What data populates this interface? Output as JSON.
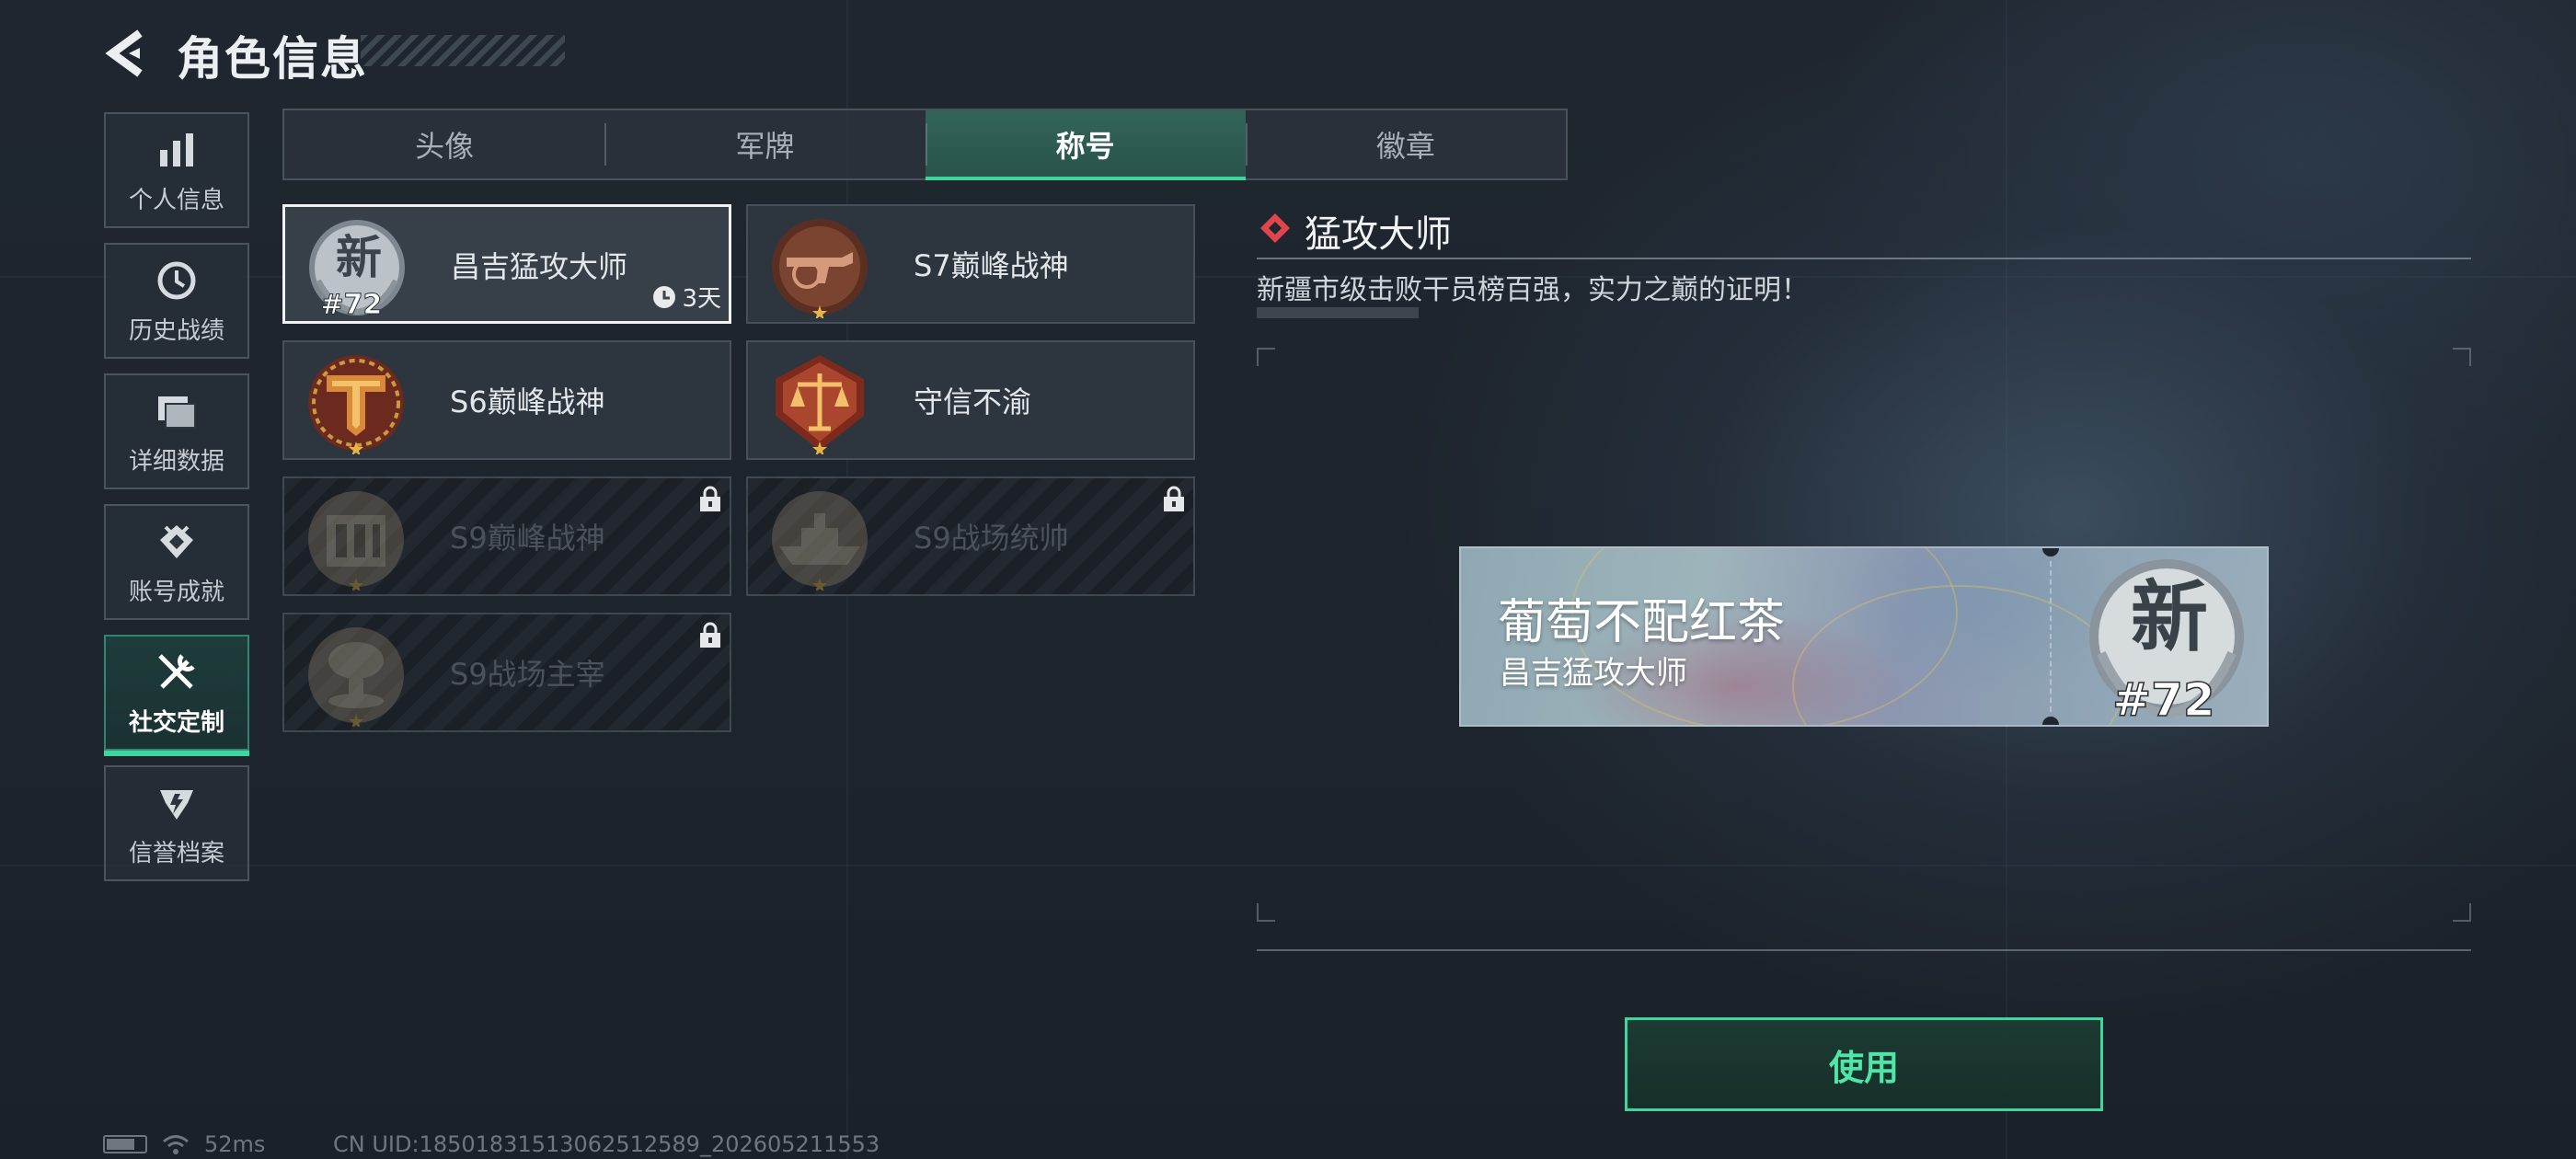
{
  "header": {
    "title": "角色信息"
  },
  "sidebar": {
    "items": [
      {
        "label": "个人信息",
        "icon": "bar-chart-icon",
        "active": false
      },
      {
        "label": "历史战绩",
        "icon": "clock-icon",
        "active": false
      },
      {
        "label": "详细数据",
        "icon": "folder-icon",
        "active": false
      },
      {
        "label": "账号成就",
        "icon": "achievement-icon",
        "active": false
      },
      {
        "label": "社交定制",
        "icon": "tools-icon",
        "active": true
      },
      {
        "label": "信誉档案",
        "icon": "credit-badge-icon",
        "active": false
      }
    ]
  },
  "tabs": [
    {
      "label": "头像",
      "active": false
    },
    {
      "label": "军牌",
      "active": false
    },
    {
      "label": "称号",
      "active": true
    },
    {
      "label": "徽章",
      "active": false
    }
  ],
  "titles": [
    {
      "name": "昌吉猛攻大师",
      "emblem": "xin-rank-emblem",
      "rank": "#72",
      "emblem_text": "新",
      "timer": "3天",
      "selected": true,
      "locked": false
    },
    {
      "name": "S7巅峰战神",
      "emblem": "rifle-emblem",
      "selected": false,
      "locked": false
    },
    {
      "name": "S6巅峰战神",
      "emblem": "t-shield-emblem",
      "selected": false,
      "locked": false
    },
    {
      "name": "守信不渝",
      "emblem": "scales-emblem",
      "selected": false,
      "locked": false
    },
    {
      "name": "S9巅峰战神",
      "emblem": "tower-emblem",
      "selected": false,
      "locked": true
    },
    {
      "name": "S9战场统帅",
      "emblem": "ship-emblem",
      "selected": false,
      "locked": true
    },
    {
      "name": "S9战场主宰",
      "emblem": "mushroom-cloud-emblem",
      "selected": false,
      "locked": true
    }
  ],
  "detail": {
    "title": "猛攻大师",
    "description": "新疆市级击败干员榜百强，实力之巅的证明！"
  },
  "preview": {
    "player_name": "葡萄不配红茶",
    "title": "昌吉猛攻大师",
    "emblem_text": "新",
    "rank": "#72"
  },
  "actions": {
    "use_label": "使用"
  },
  "status": {
    "ping": "52ms",
    "uid": "CN UID:18501831513062512589_202605211553"
  },
  "colors": {
    "accent": "#3ed69d",
    "diamond": "#e0454b",
    "background": "#1f262f"
  }
}
